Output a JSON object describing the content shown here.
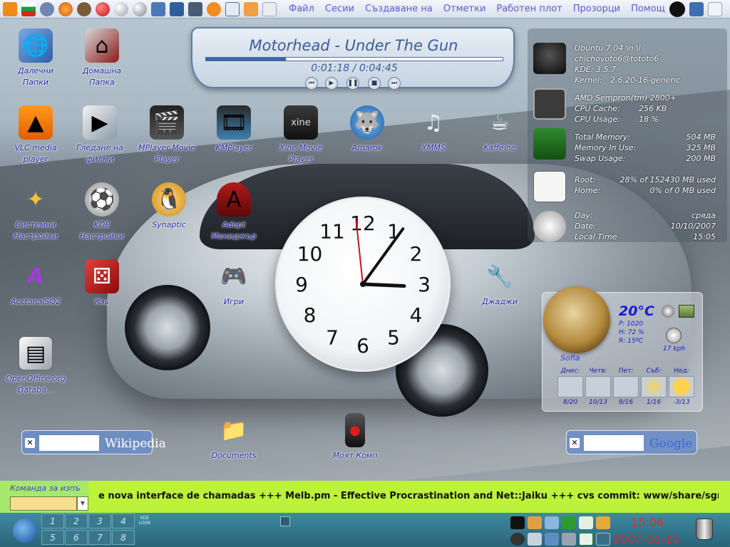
{
  "top_panel": {
    "menus": [
      "Файл",
      "Сесии",
      "Създаване на",
      "Отметки",
      "Работен плот",
      "Прозорци",
      "Помощ"
    ],
    "quick_icons": [
      "vlc-icon",
      "bulgarian-flag-icon",
      "gear-star-icon",
      "firefox-icon",
      "compass-icon",
      "red-ball-icon",
      "white-ball-icon",
      "gray-ball-icon",
      "network-icon",
      "blue-tool-icon",
      "photo-icon",
      "feed-icon",
      "molecule-icon",
      "image-icon",
      "window-icon"
    ]
  },
  "desktop_icons": [
    {
      "label": "Далечни Папки",
      "icon": "network-folder-icon"
    },
    {
      "label": "Домашна Папка",
      "icon": "home-folder-icon"
    },
    {
      "label": "VLC media player",
      "icon": "vlc-cone-icon"
    },
    {
      "label": "Гледане на филми",
      "icon": "movie-player-icon"
    },
    {
      "label": "MPlayer Movie Player",
      "icon": "clapperboard-icon"
    },
    {
      "label": "KMPlayer",
      "icon": "film-strip-icon"
    },
    {
      "label": "Xine Movie Player",
      "icon": "xine-icon"
    },
    {
      "label": "Amarok",
      "icon": "wolf-icon"
    },
    {
      "label": "XMMS",
      "icon": "music-notes-icon"
    },
    {
      "label": "Kaffeine",
      "icon": "coffee-cup-icon"
    },
    {
      "label": "Системни Настройки",
      "icon": "star-fighter-icon"
    },
    {
      "label": "KDE Настройки",
      "icon": "soccer-ball-icon"
    },
    {
      "label": "Synaptic",
      "icon": "tux-icon"
    },
    {
      "label": "Adept Мениджър",
      "icon": "hooded-figure-icon"
    },
    {
      "label": "AcctonalSO2",
      "icon": "letter-a-icon"
    },
    {
      "label": "Кэь",
      "icon": "dice-icon"
    },
    {
      "label": "Игри",
      "icon": "gamepad-icon"
    },
    {
      "label": "Джаджи",
      "icon": "tools-icon"
    },
    {
      "label": "OpenOffice.org Databa...",
      "icon": "database-icon"
    },
    {
      "label": "Documents",
      "icon": "documents-folder-icon"
    },
    {
      "label": "Моят Комп",
      "icon": "hal-computer-icon"
    }
  ],
  "media_player": {
    "track": "Motorhead - Under The Gun",
    "elapsed": "0:01:18",
    "total": "0:04:45",
    "progress": 0.27,
    "controls": [
      "prev-icon",
      "play-icon",
      "pause-icon",
      "stop-icon",
      "next-icon"
    ]
  },
  "clock": {
    "numbers": [
      "12",
      "1",
      "2",
      "3",
      "4",
      "5",
      "6",
      "7",
      "8",
      "9",
      "10",
      "11"
    ],
    "hour": 3,
    "minute": 5,
    "second": 59
  },
  "system_monitor": {
    "os": "Ubuntu 7.04 \\n \\l",
    "user": "chichovoto6@tototo6",
    "kde": "KDE: 3.5.7",
    "kernel_label": "Kernel:",
    "kernel": "2.6.20-16-generic",
    "cpu": "AMD Sempron(tm) 2800+",
    "cpu_cache_label": "CPU Cache:",
    "cpu_cache": "256 KB",
    "cpu_usage_label": "CPU Usage:",
    "cpu_usage": "18 %",
    "total_memory_label": "Total Memory:",
    "total_memory": "504 MB",
    "memory_in_use_label": "Memory In Use:",
    "memory_in_use": "325 MB",
    "swap_usage_label": "Swap Usage:",
    "swap_usage": "200 MB",
    "root_label": "Root:",
    "root": "28% of 152430 MB used",
    "home_label": "Home:",
    "home": "0% of 0 MB used",
    "day_label": "Day:",
    "day": "сряда",
    "date_label": "Date:",
    "date": "10/10/2007",
    "local_time_label": "Local Time",
    "local_time": "15:05"
  },
  "weather": {
    "temperature": "20°C",
    "pressure": "P: 1020",
    "humidity": "H: 72 %",
    "real_feel": "R: 15ºC",
    "wind": "17 kph",
    "city": "Sofia",
    "forecast": [
      {
        "day": "Днес:",
        "temps": "8/20",
        "icon": "cloudy-icon"
      },
      {
        "day": "Четв:",
        "temps": "10/13",
        "icon": "cloudy-icon"
      },
      {
        "day": "Пет:",
        "temps": "9/16",
        "icon": "cloudy-icon"
      },
      {
        "day": "Съб:",
        "temps": "1/16",
        "icon": "partly-sunny-icon"
      },
      {
        "day": "Нед:",
        "temps": "-3/13",
        "icon": "sunny-icon"
      }
    ]
  },
  "wikipedia_search": {
    "brand": "Wikipedia",
    "value": ""
  },
  "google_search": {
    "brand": "Google",
    "value": ""
  },
  "bottom_panel": {
    "command_label": "Команда за изпъ",
    "command_value": "",
    "ticker": "e nova interface de chamadas +++ Melb.pm - Effective Procrastination and Net::Jaiku +++ cvs commit: www/share/sgml u",
    "pager": [
      "1",
      "2",
      "3",
      "4",
      "5",
      "6",
      "7",
      "8"
    ],
    "kde_look_label": "KDE LOOK",
    "time": "15:06",
    "date": "2007-10-10",
    "colors": {
      "time": "#d0312d",
      "ticker_bg": "#bcf23a",
      "panel": "#2f6f85"
    }
  }
}
